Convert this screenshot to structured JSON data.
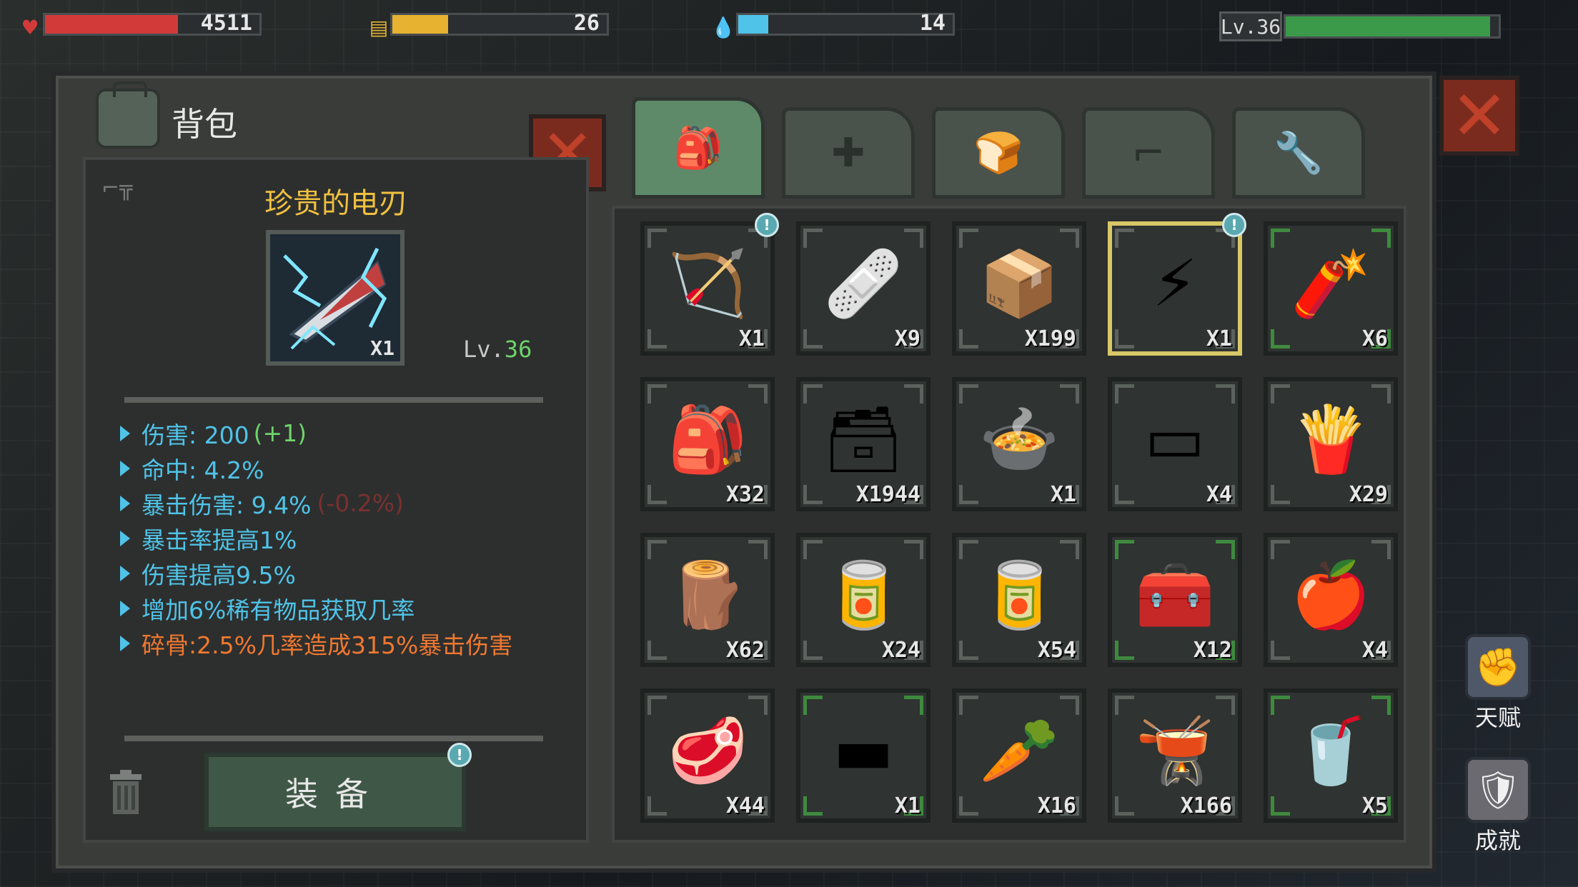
{
  "hud": {
    "health": {
      "value": "4511",
      "fill": 0.62,
      "color": "#d23a3a",
      "icon": "heart-icon"
    },
    "food": {
      "value": "26",
      "fill": 0.26,
      "color": "#e6b230",
      "icon": "food-icon"
    },
    "water": {
      "value": "14",
      "fill": 0.14,
      "color": "#4fc3e8",
      "icon": "water-icon"
    },
    "level": {
      "label": "Lv.36",
      "fill": 0.96,
      "color": "#3a9a4a"
    }
  },
  "panel": {
    "title": "背包",
    "tabs": [
      {
        "name": "backpack",
        "icon": "backpack-icon",
        "active": true
      },
      {
        "name": "medical",
        "icon": "medkit-icon",
        "active": false
      },
      {
        "name": "food",
        "icon": "bread-icon",
        "active": false
      },
      {
        "name": "weapons",
        "icon": "gun-icon",
        "active": false
      },
      {
        "name": "tools",
        "icon": "wrench-icon",
        "active": false
      }
    ]
  },
  "detail": {
    "name": "珍贵的电刃",
    "count": "X1",
    "level_prefix": "Lv.",
    "level_value": "36",
    "stats": [
      {
        "label": "伤害: 200",
        "extra": "(+1)",
        "extra_type": "g",
        "style": "blue"
      },
      {
        "label": "命中: 4.2%",
        "extra": "",
        "extra_type": "",
        "style": "blue"
      },
      {
        "label": "暴击伤害: 9.4%",
        "extra": "(-0.2%)",
        "extra_type": "r",
        "style": "blue"
      },
      {
        "label": "暴击率提高1%",
        "extra": "",
        "extra_type": "",
        "style": "blue"
      },
      {
        "label": "伤害提高9.5%",
        "extra": "",
        "extra_type": "",
        "style": "blue"
      },
      {
        "label": "增加6%稀有物品获取几率",
        "extra": "",
        "extra_type": "",
        "style": "blue"
      },
      {
        "label": "碎骨:2.5%几率造成315%暴击伤害",
        "extra": "",
        "extra_type": "",
        "style": "orange"
      }
    ],
    "equip_label": "装备"
  },
  "inventory": [
    {
      "icon": "crossbow-icon",
      "glyph": "🏹",
      "count": "X1",
      "frame": "normal",
      "badge": true,
      "selected": false
    },
    {
      "icon": "bandage-icon",
      "glyph": "🩹",
      "count": "X9",
      "frame": "normal",
      "badge": false,
      "selected": false
    },
    {
      "icon": "ammo-box-icon",
      "glyph": "📦",
      "count": "X199",
      "frame": "normal",
      "badge": false,
      "selected": false
    },
    {
      "icon": "electric-blade-icon",
      "glyph": "⚡",
      "count": "X1",
      "frame": "normal",
      "badge": true,
      "selected": true
    },
    {
      "icon": "dynamite-icon",
      "glyph": "🧨",
      "count": "X6",
      "frame": "green",
      "badge": false,
      "selected": false
    },
    {
      "icon": "medical-bag-icon",
      "glyph": "🎒",
      "count": "X32",
      "frame": "normal",
      "badge": false,
      "selected": false
    },
    {
      "icon": "rifle-ammo-crate-icon",
      "glyph": "🗃",
      "count": "X1944",
      "frame": "normal",
      "badge": false,
      "selected": false
    },
    {
      "icon": "dirty-water-pot-icon",
      "glyph": "🍲",
      "count": "X1",
      "frame": "normal",
      "badge": false,
      "selected": false
    },
    {
      "icon": "cloth-icon",
      "glyph": "▭",
      "count": "X4",
      "frame": "normal",
      "badge": false,
      "selected": false
    },
    {
      "icon": "chips-bag-icon",
      "glyph": "🍟",
      "count": "X29",
      "frame": "normal",
      "badge": false,
      "selected": false
    },
    {
      "icon": "coal-wood-icon",
      "glyph": "🪵",
      "count": "X62",
      "frame": "normal",
      "badge": false,
      "selected": false
    },
    {
      "icon": "bean-can-icon",
      "glyph": "🥫",
      "count": "X24",
      "frame": "normal",
      "badge": false,
      "selected": false
    },
    {
      "icon": "soup-can-icon",
      "glyph": "🥫",
      "count": "X54",
      "frame": "normal",
      "badge": false,
      "selected": false
    },
    {
      "icon": "toolbox-icon",
      "glyph": "🧰",
      "count": "X12",
      "frame": "green",
      "badge": false,
      "selected": false
    },
    {
      "icon": "apple-icon",
      "glyph": "🍎",
      "count": "X4",
      "frame": "normal",
      "badge": false,
      "selected": false
    },
    {
      "icon": "raw-meat-icon",
      "glyph": "🥩",
      "count": "X44",
      "frame": "normal",
      "badge": false,
      "selected": false
    },
    {
      "icon": "metal-plate-icon",
      "glyph": "▬",
      "count": "X1",
      "frame": "green",
      "badge": false,
      "selected": false
    },
    {
      "icon": "carrot-icon",
      "glyph": "🥕",
      "count": "X16",
      "frame": "normal",
      "badge": false,
      "selected": false
    },
    {
      "icon": "clean-water-pot-icon",
      "glyph": "🫕",
      "count": "X166",
      "frame": "normal",
      "badge": false,
      "selected": false
    },
    {
      "icon": "juice-icon",
      "glyph": "🥤",
      "count": "X5",
      "frame": "green",
      "badge": false,
      "selected": false
    }
  ],
  "side": {
    "talent_label": "天赋",
    "achievement_label": "成就"
  }
}
